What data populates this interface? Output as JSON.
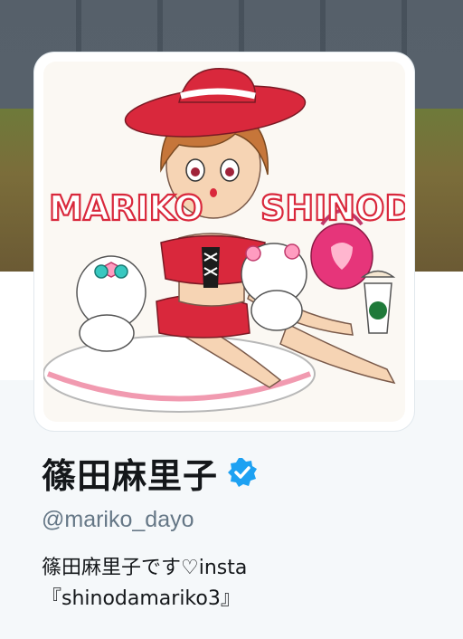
{
  "profile": {
    "display_name": "篠田麻里子",
    "handle": "@mariko_dayo",
    "bio_line1": "篠田麻里子です♡insta",
    "bio_line2": "『shinodamariko3』"
  },
  "avatar": {
    "art_text_left": "MARIKO",
    "art_text_right": "SHINODA"
  },
  "icons": {
    "verified": "verified-badge-icon"
  },
  "colors": {
    "verified_blue": "#1da1f2",
    "name_text": "#14171a",
    "handle_text": "#657786",
    "background": "#f5f8fa"
  }
}
